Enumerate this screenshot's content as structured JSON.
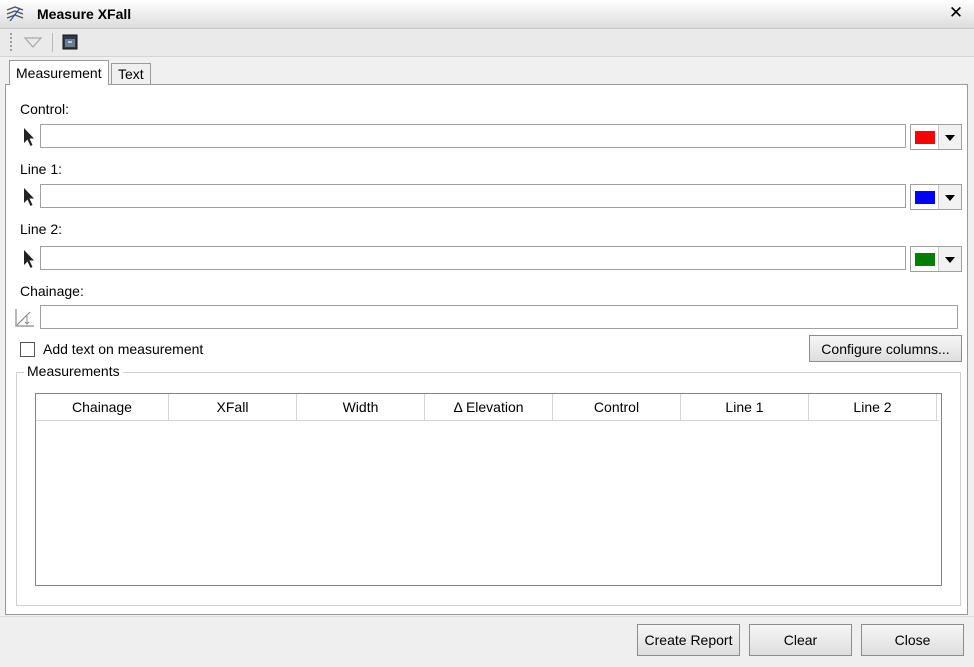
{
  "window": {
    "title": "Measure XFall",
    "close_glyph": "✕"
  },
  "toolbar": {
    "icons": [
      "triangle-dropdown-icon",
      "window-icon"
    ]
  },
  "tabs": [
    {
      "label": "Measurement",
      "active": true
    },
    {
      "label": "Text",
      "active": false
    }
  ],
  "form": {
    "control": {
      "label": "Control:",
      "value": "",
      "color": "#ff0000"
    },
    "line1": {
      "label": "Line 1:",
      "value": "",
      "color": "#0000ff"
    },
    "line2": {
      "label": "Line 2:",
      "value": "",
      "color": "#008000"
    },
    "chainage": {
      "label": "Chainage:",
      "value": ""
    },
    "add_text": {
      "label": "Add text on measurement",
      "checked": false
    },
    "configure_label": "Configure columns..."
  },
  "measurements": {
    "title": "Measurements",
    "columns": [
      "Chainage",
      "XFall",
      "Width",
      "Δ Elevation",
      "Control",
      "Line 1",
      "Line 2"
    ],
    "rows": []
  },
  "footer": {
    "create_report": "Create Report",
    "clear": "Clear",
    "close": "Close"
  }
}
